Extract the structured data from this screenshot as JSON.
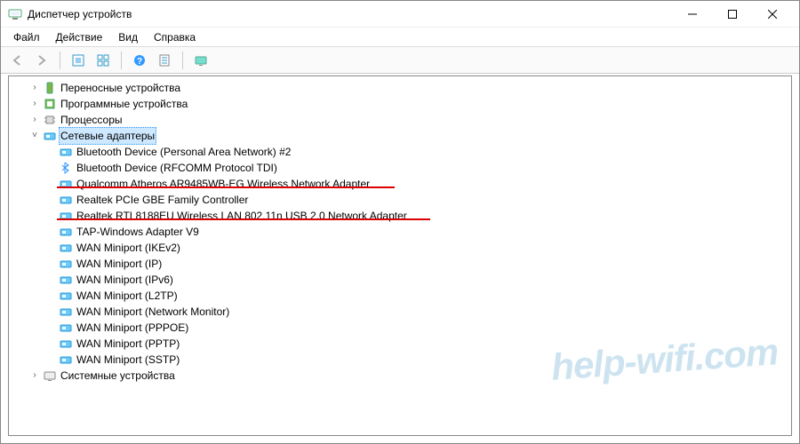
{
  "window": {
    "title": "Диспетчер устройств"
  },
  "menubar": {
    "file": "Файл",
    "action": "Действие",
    "view": "Вид",
    "help": "Справка"
  },
  "tree": {
    "cat_portable": "Переносные устройства",
    "cat_software": "Программные устройства",
    "cat_processors": "Процессоры",
    "cat_network": "Сетевые адаптеры",
    "net1": "Bluetooth Device (Personal Area Network) #2",
    "net2": "Bluetooth Device (RFCOMM Protocol TDI)",
    "net3": "Qualcomm Atheros AR9485WB-EG Wireless Network Adapter",
    "net4": "Realtek PCIe GBE Family Controller",
    "net5": "Realtek RTL8188EU Wireless LAN 802.11n USB 2.0 Network Adapter",
    "net6": "TAP-Windows Adapter V9",
    "net7": "WAN Miniport (IKEv2)",
    "net8": "WAN Miniport (IP)",
    "net9": "WAN Miniport (IPv6)",
    "net10": "WAN Miniport (L2TP)",
    "net11": "WAN Miniport (Network Monitor)",
    "net12": "WAN Miniport (PPPOE)",
    "net13": "WAN Miniport (PPTP)",
    "net14": "WAN Miniport (SSTP)",
    "cat_system": "Системные устройства"
  },
  "watermark": "help-wifi.com"
}
